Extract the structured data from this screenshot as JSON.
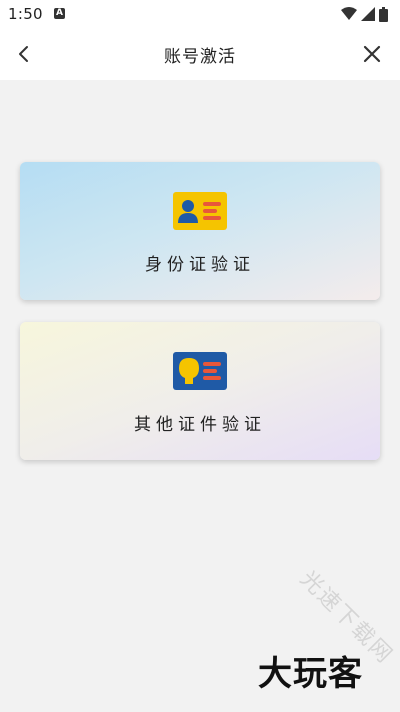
{
  "status_bar": {
    "time": "1:50",
    "notification_icon": "a-letter-icon",
    "icons": [
      "wifi-icon",
      "signal-icon",
      "battery-icon"
    ]
  },
  "header": {
    "title": "账号激活",
    "back_icon": "chevron-left-icon",
    "close_icon": "close-icon"
  },
  "options": [
    {
      "label": "身份证验证",
      "icon": "id-card-icon",
      "icon_bg": "#f5c400",
      "icon_fg": "#1f5aa6",
      "icon_line": "#e8573a"
    },
    {
      "label": "其他证件验证",
      "icon": "id-card-icon",
      "icon_bg": "#1f5aa6",
      "icon_fg": "#f5c400",
      "icon_line": "#e8573a"
    }
  ],
  "watermark": {
    "logo": "大玩客",
    "diagonal": "光速下载网"
  },
  "colors": {
    "background": "#f2f2f2",
    "header_bg": "#ffffff",
    "text": "#222222"
  }
}
